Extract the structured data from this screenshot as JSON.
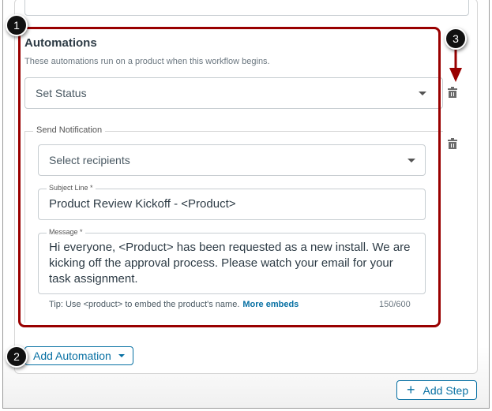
{
  "automations": {
    "title": "Automations",
    "description": "These automations run on a product when this workflow begins.",
    "set_status": {
      "value": "Set Status"
    },
    "send_notification": {
      "legend": "Send Notification",
      "recipients_placeholder": "Select recipients",
      "subject_label": "Subject Line *",
      "subject_value": "Product Review Kickoff - <Product>",
      "message_label": "Message *",
      "message_value": "Hi everyone, <Product> has been requested as a new install. We are kicking off the approval process. Please watch your email for your task assignment.",
      "tip": "Tip: Use <product> to embed the product's name.",
      "more_embeds": "More embeds",
      "char_count": "150/600"
    }
  },
  "add_automation_label": "Add Automation",
  "add_step_label": "Add Step",
  "badges": [
    "1",
    "2",
    "3"
  ],
  "colors": {
    "highlight": "#990000",
    "accent": "#0770a3"
  }
}
